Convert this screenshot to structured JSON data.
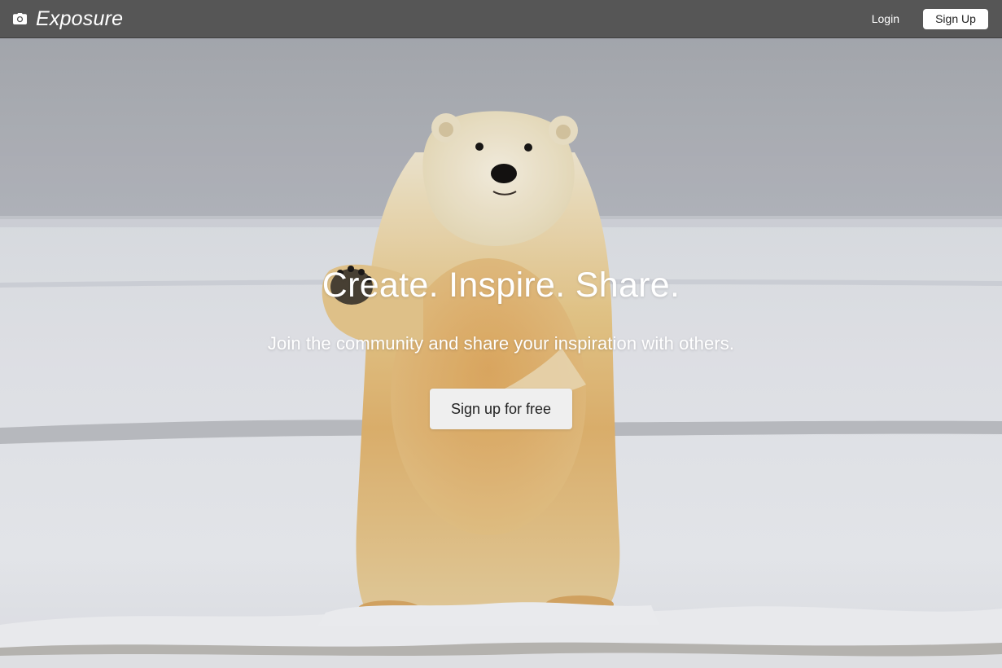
{
  "navbar": {
    "brand_name": "Exposure",
    "brand_icon": "camera-icon",
    "login_label": "Login",
    "signup_label": "Sign Up"
  },
  "hero": {
    "headline": "Create. Inspire. Share.",
    "subheadline": "Join the community and share your inspiration with others.",
    "cta_label": "Sign up for free",
    "background_image": "polar bear standing on snow, waving"
  },
  "colors": {
    "navbar_bg": "#565656",
    "text_light": "#ffffff",
    "button_bg": "#efefef"
  }
}
